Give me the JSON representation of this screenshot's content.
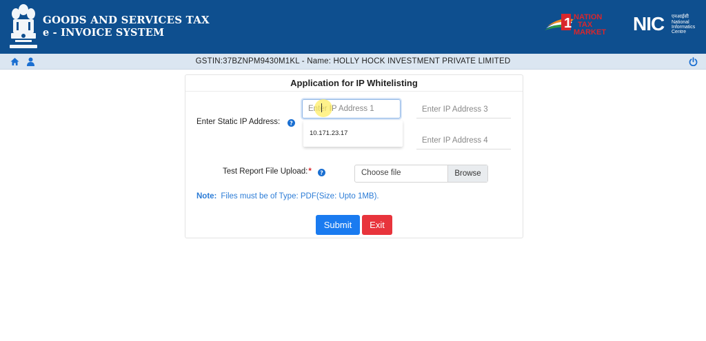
{
  "header": {
    "title_line1": "GOODS AND SERVICES TAX",
    "title_line2": "e - INVOICE SYSTEM",
    "emblem_icon": "state-emblem-icon",
    "partner_logo": "nation-tax-market-logo",
    "nic_logo": "nic-logo"
  },
  "infobar": {
    "gstin_text": "GSTIN:37BZNPM9430M1KL - Name: HOLLY HOCK INVESTMENT PRIVATE LIMITED",
    "home_icon": "home-icon",
    "user_icon": "user-icon",
    "logout_icon": "power-icon"
  },
  "form": {
    "title": "Application for IP Whitelisting",
    "static_ip_label": "Enter Static IP Address:",
    "ip1_placeholder": "Enter IP Address 1",
    "ip3_placeholder": "Enter IP Address 3",
    "ip4_placeholder": "Enter IP Address 4",
    "suggestion": "10.171.23.17",
    "upload_label": "Test Report File Upload:",
    "required_mark": "*",
    "file_placeholder": "Choose file",
    "browse_label": "Browse",
    "note_label": "Note:",
    "note_text": "Files must be of Type: PDF(Size: Upto 1MB).",
    "submit_label": "Submit",
    "exit_label": "Exit"
  },
  "colors": {
    "header_bg": "#0e4f8f",
    "infobar_bg": "#dbe6f1",
    "submit_bg": "#1a7bf0",
    "exit_bg": "#e8343c",
    "note_color": "#2a7bd6",
    "required_color": "#d9262c"
  }
}
